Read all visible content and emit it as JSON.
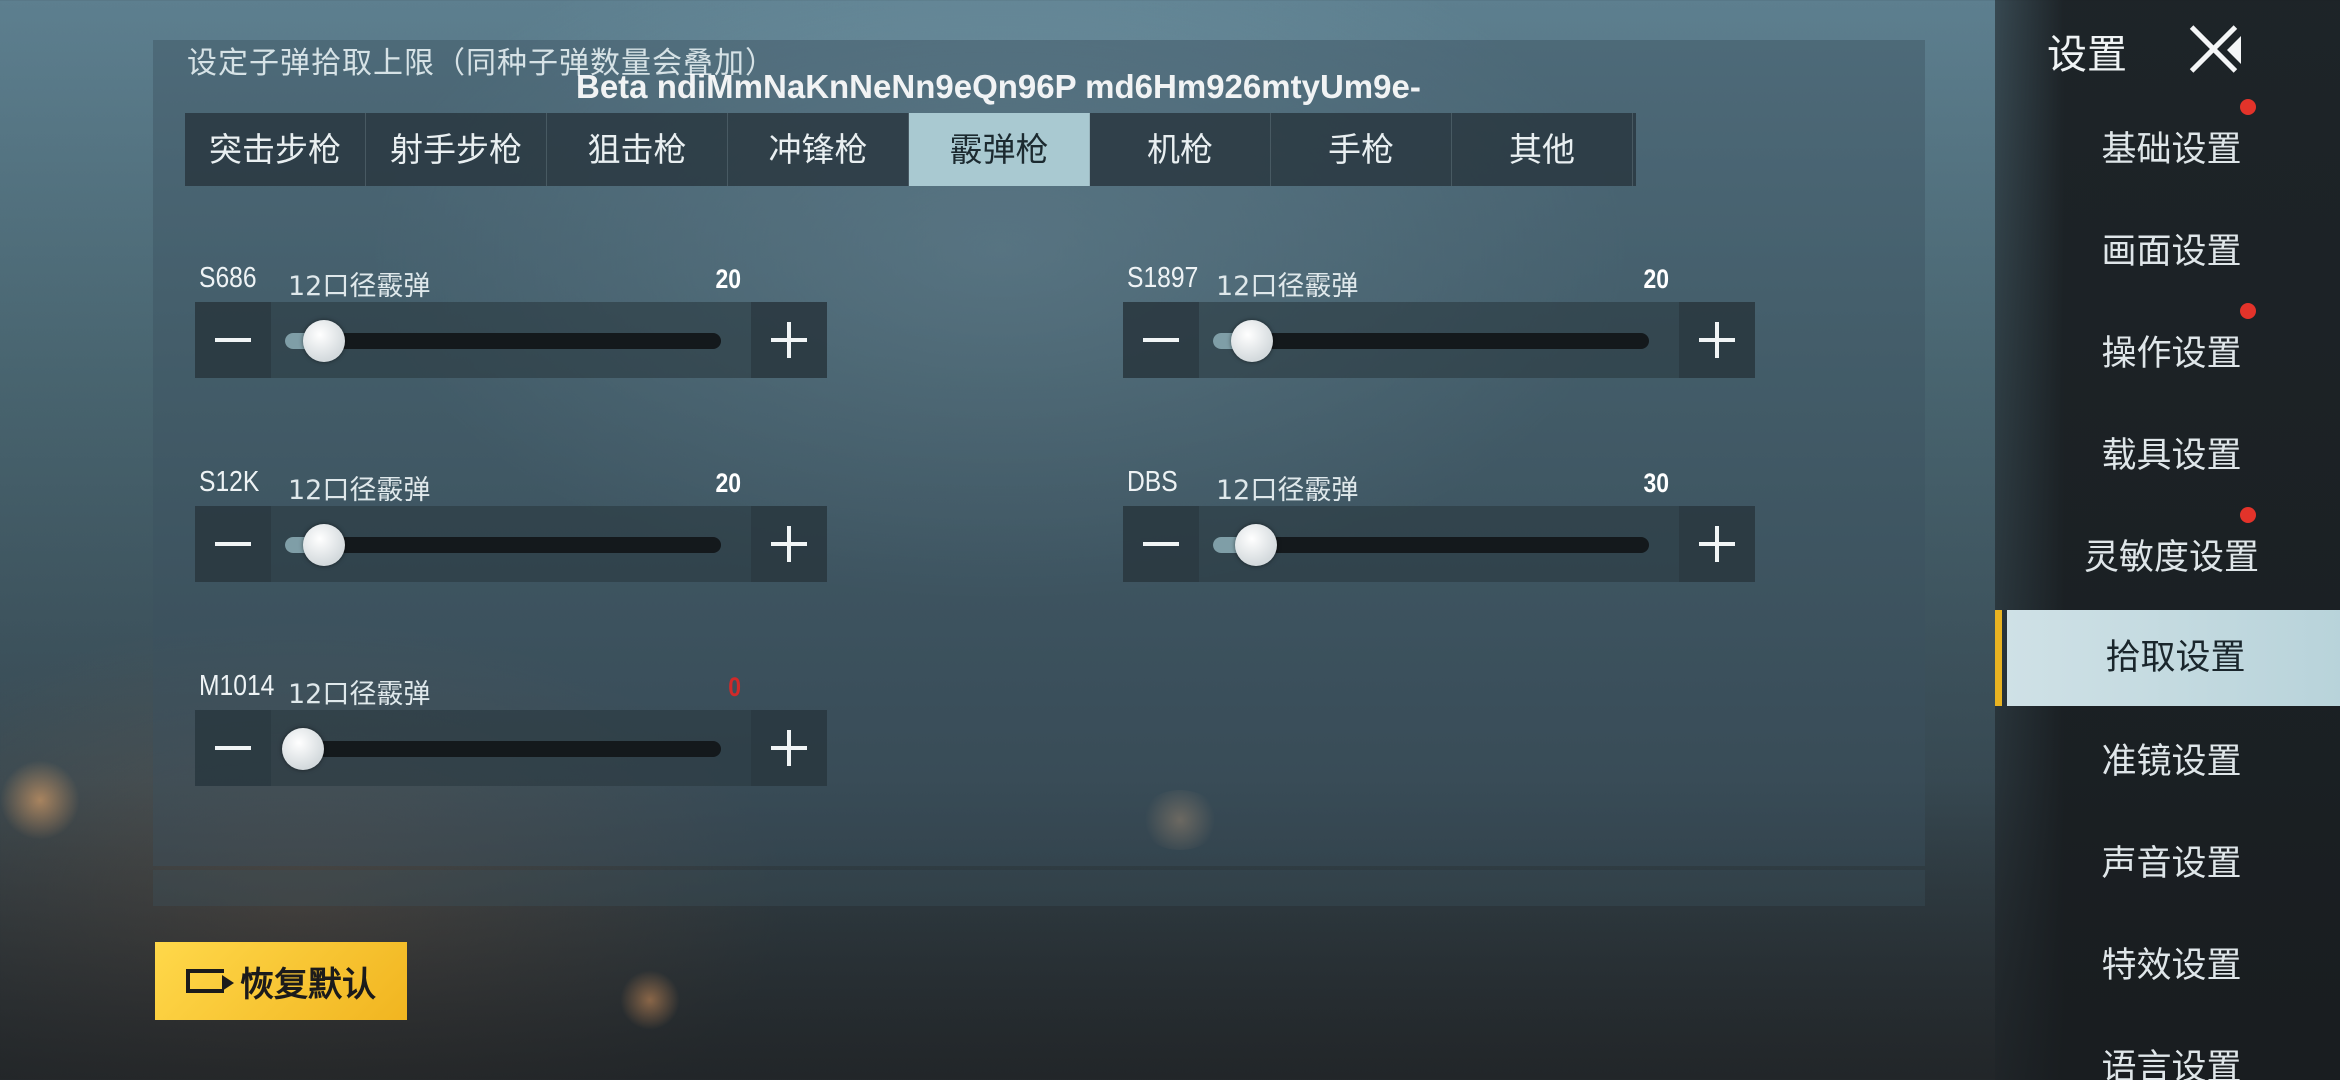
{
  "header": {
    "hint": "设定子弹拾取上限（同种子弹数量会叠加）",
    "watermark": "Beta ndiMmNaKnNeNn9eQn96P md6Hm926mtyUm9e-"
  },
  "tabs": [
    {
      "label": "突击步枪",
      "active": false
    },
    {
      "label": "射手步枪",
      "active": false
    },
    {
      "label": "狙击枪",
      "active": false
    },
    {
      "label": "冲锋枪",
      "active": false
    },
    {
      "label": "霰弹枪",
      "active": true
    },
    {
      "label": "机枪",
      "active": false
    },
    {
      "label": "手枪",
      "active": false
    },
    {
      "label": "其他",
      "active": false
    }
  ],
  "weapons": [
    {
      "name": "S686",
      "ammo": "12口径霰弹",
      "value": "20",
      "level": 0.05
    },
    {
      "name": "S1897",
      "ammo": "12口径霰弹",
      "value": "20",
      "level": 0.05
    },
    {
      "name": "S12K",
      "ammo": "12口径霰弹",
      "value": "20",
      "level": 0.05
    },
    {
      "name": "DBS",
      "ammo": "12口径霰弹",
      "value": "30",
      "level": 0.06
    },
    {
      "name": "M1014",
      "ammo": "12口径霰弹",
      "value": "0",
      "level": 0.0
    }
  ],
  "sidebar": {
    "title": "设置",
    "items": [
      {
        "label": "基础设置",
        "badge": true
      },
      {
        "label": "画面设置",
        "badge": false
      },
      {
        "label": "操作设置",
        "badge": true
      },
      {
        "label": "载具设置",
        "badge": false
      },
      {
        "label": "灵敏度设置",
        "badge": true
      },
      {
        "label": "拾取设置",
        "badge": false,
        "active": true
      },
      {
        "label": "准镜设置",
        "badge": false
      },
      {
        "label": "声音设置",
        "badge": false
      },
      {
        "label": "特效设置",
        "badge": false
      },
      {
        "label": "语言设置",
        "badge": false
      }
    ]
  },
  "footer": {
    "restore_label": "恢复默认"
  },
  "colors": {
    "accent_gold": "#e9b321",
    "active_tab": "#a9c9d1",
    "badge_red": "#e3332a",
    "zero_value_red": "#d02a2a"
  },
  "icons": [
    "minus-icon",
    "plus-icon",
    "close-icon",
    "restore-icon"
  ]
}
